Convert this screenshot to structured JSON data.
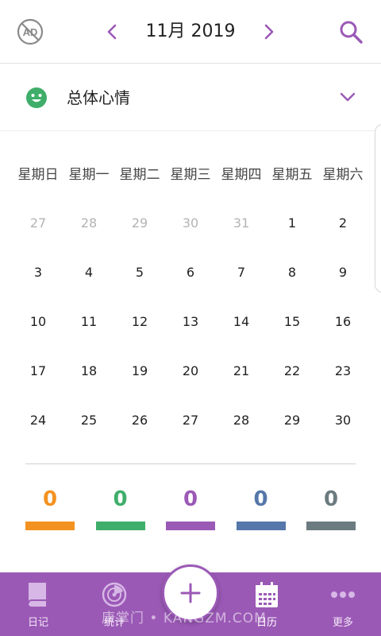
{
  "header": {
    "month_title": "11月 2019"
  },
  "mood_filter": {
    "label": "总体心情"
  },
  "calendar": {
    "weekdays": [
      "星期日",
      "星期一",
      "星期二",
      "星期三",
      "星期四",
      "星期五",
      "星期六"
    ],
    "weeks": [
      [
        "27",
        "28",
        "29",
        "30",
        "31",
        "1",
        "2"
      ],
      [
        "3",
        "4",
        "5",
        "6",
        "7",
        "8",
        "9"
      ],
      [
        "10",
        "11",
        "12",
        "13",
        "14",
        "15",
        "16"
      ],
      [
        "17",
        "18",
        "19",
        "20",
        "21",
        "22",
        "23"
      ],
      [
        "24",
        "25",
        "26",
        "27",
        "28",
        "29",
        "30"
      ]
    ]
  },
  "mood_counts": [
    {
      "value": "0",
      "color": "#f39221"
    },
    {
      "value": "0",
      "color": "#3fae6a"
    },
    {
      "value": "0",
      "color": "#9b59b6"
    },
    {
      "value": "0",
      "color": "#5577aa"
    },
    {
      "value": "0",
      "color": "#6b7b80"
    }
  ],
  "bottom_nav": {
    "tabs": [
      {
        "label": "日记",
        "icon": "book-icon"
      },
      {
        "label": "统计",
        "icon": "chart-disc-icon"
      },
      {
        "label": "日历",
        "icon": "calendar-icon"
      },
      {
        "label": "更多",
        "icon": "more-dots-icon"
      }
    ]
  },
  "watermark": "康掌门 • KANGZM.COM",
  "colors": {
    "accent": "#9b59b6",
    "mood_green": "#3fae6a"
  }
}
